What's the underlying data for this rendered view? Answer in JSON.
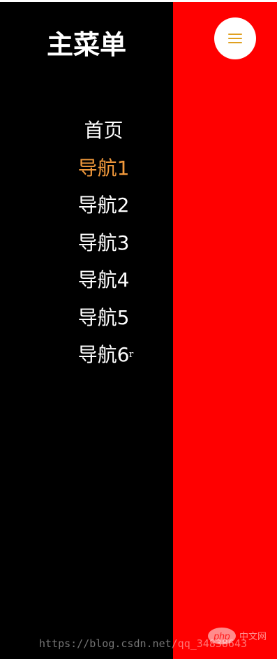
{
  "sidebar": {
    "title": "主菜单",
    "items": [
      {
        "label": "首页"
      },
      {
        "label": "导航1"
      },
      {
        "label": "导航2"
      },
      {
        "label": "导航3"
      },
      {
        "label": "导航4"
      },
      {
        "label": "导航5"
      },
      {
        "label": "导航6"
      }
    ],
    "active_index": 1
  },
  "menu_button": {
    "icon": "hamburger-menu-icon"
  },
  "cursor_glyph": "r",
  "watermark": {
    "url": "https://blog.csdn.net/qq_34838643",
    "badge": "php",
    "site": "中文网"
  },
  "colors": {
    "sidebar_bg": "#000000",
    "content_bg": "#ff0000",
    "active_item": "#f39a3c",
    "text": "#ffffff",
    "menu_icon": "#e0a020"
  }
}
